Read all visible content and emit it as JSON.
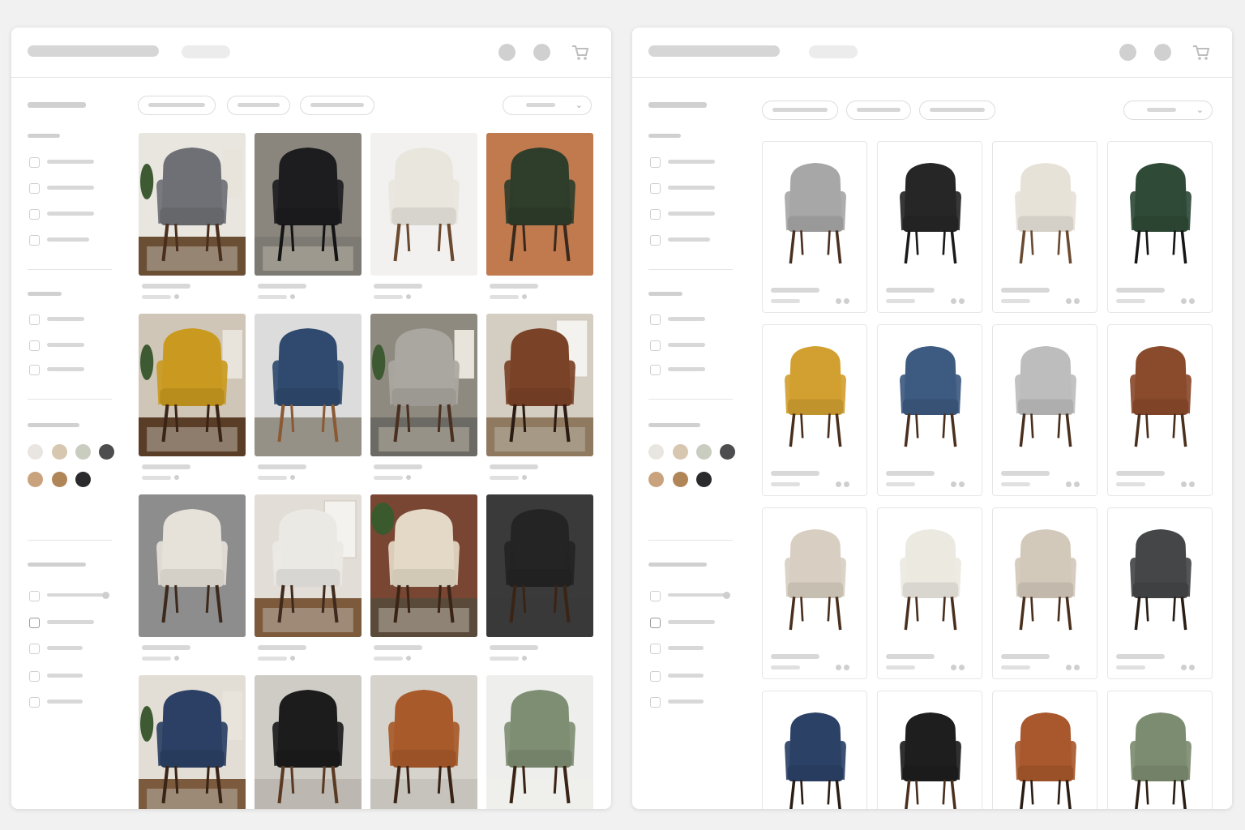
{
  "left_window": {
    "style": "lifestyle-photos",
    "products": [
      {
        "color": "#6e7075",
        "bg": "#e9e6e0",
        "floor": "#6b4f35",
        "legs": "#4a2f1d",
        "scene": "living-room"
      },
      {
        "color": "#1d1d1f",
        "bg": "#8a857d",
        "floor": "#7d7a74",
        "legs": "#141414",
        "scene": "concrete"
      },
      {
        "color": "#e9e6de",
        "bg": "#f2f1ef",
        "floor": "#f2f1ef",
        "legs": "#6b4a30",
        "scene": "studio"
      },
      {
        "color": "#2f3d2b",
        "bg": "#c07a4e",
        "floor": "#c07a4e",
        "legs": "#3a2a1e",
        "scene": "terracotta"
      },
      {
        "color": "#c99a1f",
        "bg": "#cfc6b8",
        "floor": "#5a3d27",
        "legs": "#3a2416",
        "scene": "living-room"
      },
      {
        "color": "#2f4a6e",
        "bg": "#dcdcdc",
        "floor": "#8a8478",
        "legs": "#8a5a35",
        "scene": "studio"
      },
      {
        "color": "#a9a79f",
        "bg": "#8e8a80",
        "floor": "#6c6a64",
        "legs": "#4a3020",
        "scene": "living-room"
      },
      {
        "color": "#7a4226",
        "bg": "#d4cdc2",
        "floor": "#8f7a60",
        "legs": "#2b1b12",
        "scene": "window"
      },
      {
        "color": "#e6e2da",
        "bg": "#8d8d8d",
        "floor": "#8d8d8d",
        "legs": "#3d2a1c",
        "scene": "grey"
      },
      {
        "color": "#ebe9e4",
        "bg": "#e2ddd6",
        "floor": "#7d5a3c",
        "legs": "#3f2b1d",
        "scene": "window"
      },
      {
        "color": "#e4d9c6",
        "bg": "#7a4634",
        "floor": "#5a4a3a",
        "legs": "#3a2416",
        "scene": "brick"
      },
      {
        "color": "#242424",
        "bg": "#3a3a3a",
        "floor": "#3a3a3a",
        "legs": "#3a2416",
        "scene": "dark"
      },
      {
        "color": "#2b4064",
        "bg": "#e3ded5",
        "floor": "#7b5a3d",
        "legs": "#3a2416",
        "scene": "living-room"
      },
      {
        "color": "#1c1c1c",
        "bg": "#cfccc6",
        "floor": "#b8b3ab",
        "legs": "#5a3a22",
        "scene": "studio"
      },
      {
        "color": "#a85a2a",
        "bg": "#d6d3cd",
        "floor": "#c3bfb8",
        "legs": "#3a2416",
        "scene": "studio"
      },
      {
        "color": "#7e8e72",
        "bg": "#eeeeec",
        "floor": "#eeeeec",
        "legs": "#3a2416",
        "scene": "studio"
      }
    ]
  },
  "right_window": {
    "style": "white-background",
    "products": [
      {
        "color": "#a7a7a7",
        "legs": "#4a3020"
      },
      {
        "color": "#262626",
        "legs": "#1a1a1a"
      },
      {
        "color": "#e7e2d8",
        "legs": "#6a4a30"
      },
      {
        "color": "#2f4a37",
        "legs": "#151515"
      },
      {
        "color": "#d2a030",
        "legs": "#4a2f1d"
      },
      {
        "color": "#3d5a80",
        "legs": "#4a2f1d"
      },
      {
        "color": "#bdbdbd",
        "legs": "#4a2f1d"
      },
      {
        "color": "#8a4a2c",
        "legs": "#4a2f1d"
      },
      {
        "color": "#d8cfc2",
        "legs": "#4a2f1d"
      },
      {
        "color": "#ece9e1",
        "legs": "#4a2f1d"
      },
      {
        "color": "#d3c9bb",
        "legs": "#4a2f1d"
      },
      {
        "color": "#444648",
        "legs": "#2a1d14"
      },
      {
        "color": "#2b4266",
        "legs": "#2a1d14"
      },
      {
        "color": "#1e1e1e",
        "legs": "#4a2f1d"
      },
      {
        "color": "#a8582c",
        "legs": "#2a1d14"
      },
      {
        "color": "#7c8c70",
        "legs": "#2a1d14"
      }
    ]
  },
  "swatches": [
    "#e9e6e1",
    "#d7c7b0",
    "#c9cdc0",
    "#4d4d4f",
    "#c9a27e",
    "#b08658",
    "#2a2a2c"
  ],
  "icons": {
    "cart": "cart-icon",
    "account": "user-icon",
    "wishlist": "heart-icon"
  }
}
